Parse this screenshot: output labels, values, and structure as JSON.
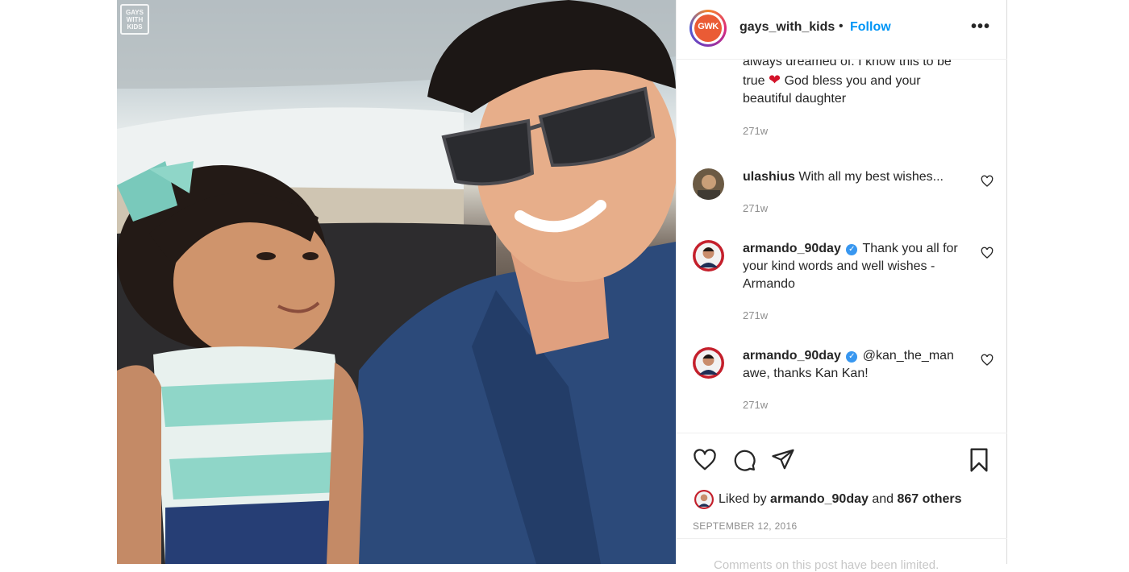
{
  "post": {
    "watermark": "GAYS WITH KIDS",
    "account": {
      "avatar_text": "GWK",
      "username": "gays_with_kids",
      "separator": "•",
      "follow_label": "Follow",
      "more_icon": "more-options-icon"
    },
    "comments": [
      {
        "text_before_emoji": "always dreamed of. I know this to be true",
        "emoji": "❤",
        "text_after_emoji": "God bless you and your beautiful daughter",
        "time": "271w"
      },
      {
        "username": "ulashius",
        "text": "With all my best wishes...",
        "time": "271w"
      },
      {
        "username": "armando_90day",
        "verified": true,
        "text": "Thank you all for your kind words and well wishes - Armando",
        "time": "271w"
      },
      {
        "username": "armando_90day",
        "verified": true,
        "text": "@kan_the_man awe, thanks Kan Kan!",
        "time": "271w"
      }
    ],
    "actions": {
      "like_icon": "heart-icon",
      "comment_icon": "comment-icon",
      "share_icon": "share-icon",
      "save_icon": "bookmark-icon"
    },
    "likes": {
      "prefix": "Liked by",
      "user": "armando_90day",
      "conjunction": "and",
      "others": "867 others"
    },
    "date": "SEPTEMBER 12, 2016",
    "comments_limited": "Comments on this post have been limited."
  }
}
